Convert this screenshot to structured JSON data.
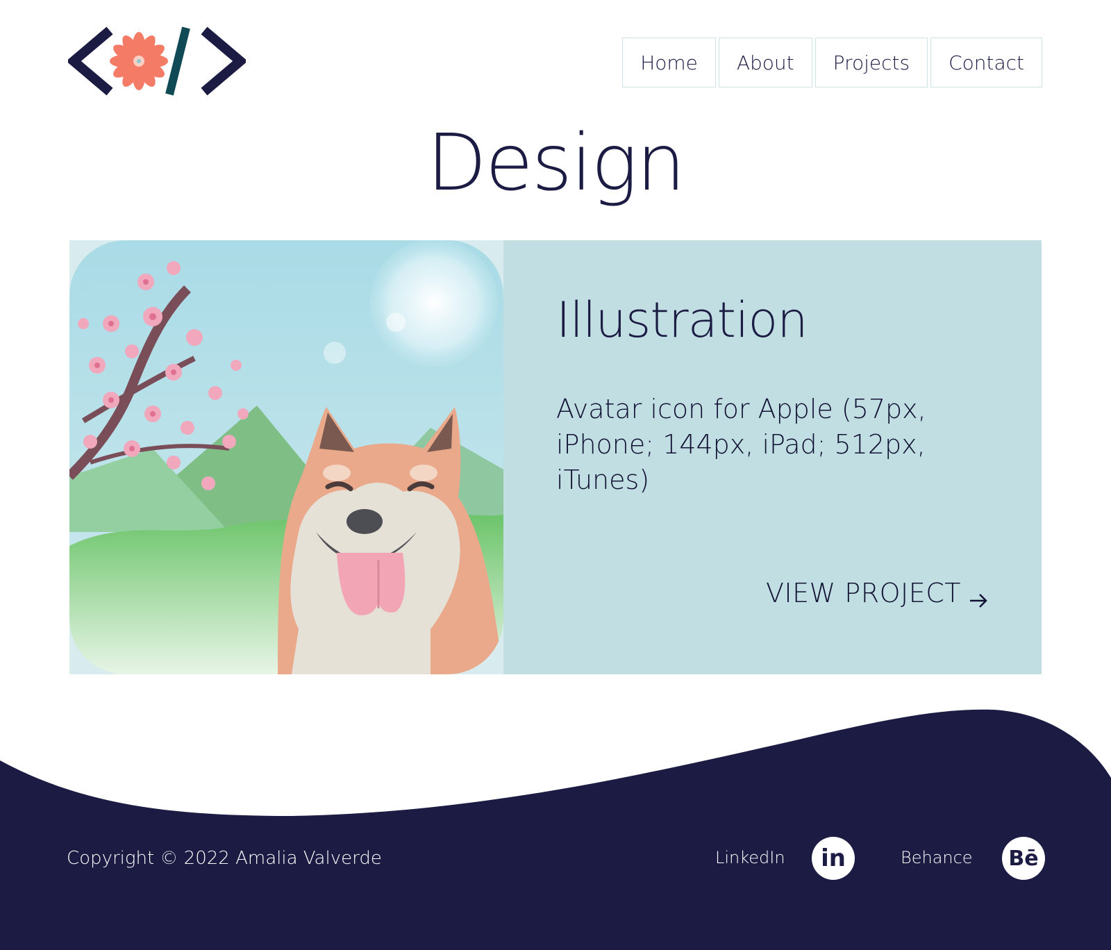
{
  "nav": {
    "items": [
      {
        "label": "Home"
      },
      {
        "label": "About"
      },
      {
        "label": "Projects"
      },
      {
        "label": "Contact"
      }
    ]
  },
  "page": {
    "title": "Design"
  },
  "project": {
    "title": "Illustration",
    "description": "Avatar icon for Apple (57px, iPhone; 144px, iPad; 512px, iTunes)",
    "link_label": "VIEW PROJECT"
  },
  "footer": {
    "copyright": "Copyright © 2022 Amalia Valverde",
    "social": [
      {
        "label": "LinkedIn",
        "icon": "linkedin-icon",
        "glyph": "in"
      },
      {
        "label": "Behance",
        "icon": "behance-icon",
        "glyph": "Bē"
      }
    ]
  },
  "colors": {
    "navy": "#1b1b44",
    "card_bg": "#c1dfe3",
    "nav_border": "#cfe4e6",
    "logo_flower": "#f47c66",
    "logo_slash": "#0f4a55"
  }
}
